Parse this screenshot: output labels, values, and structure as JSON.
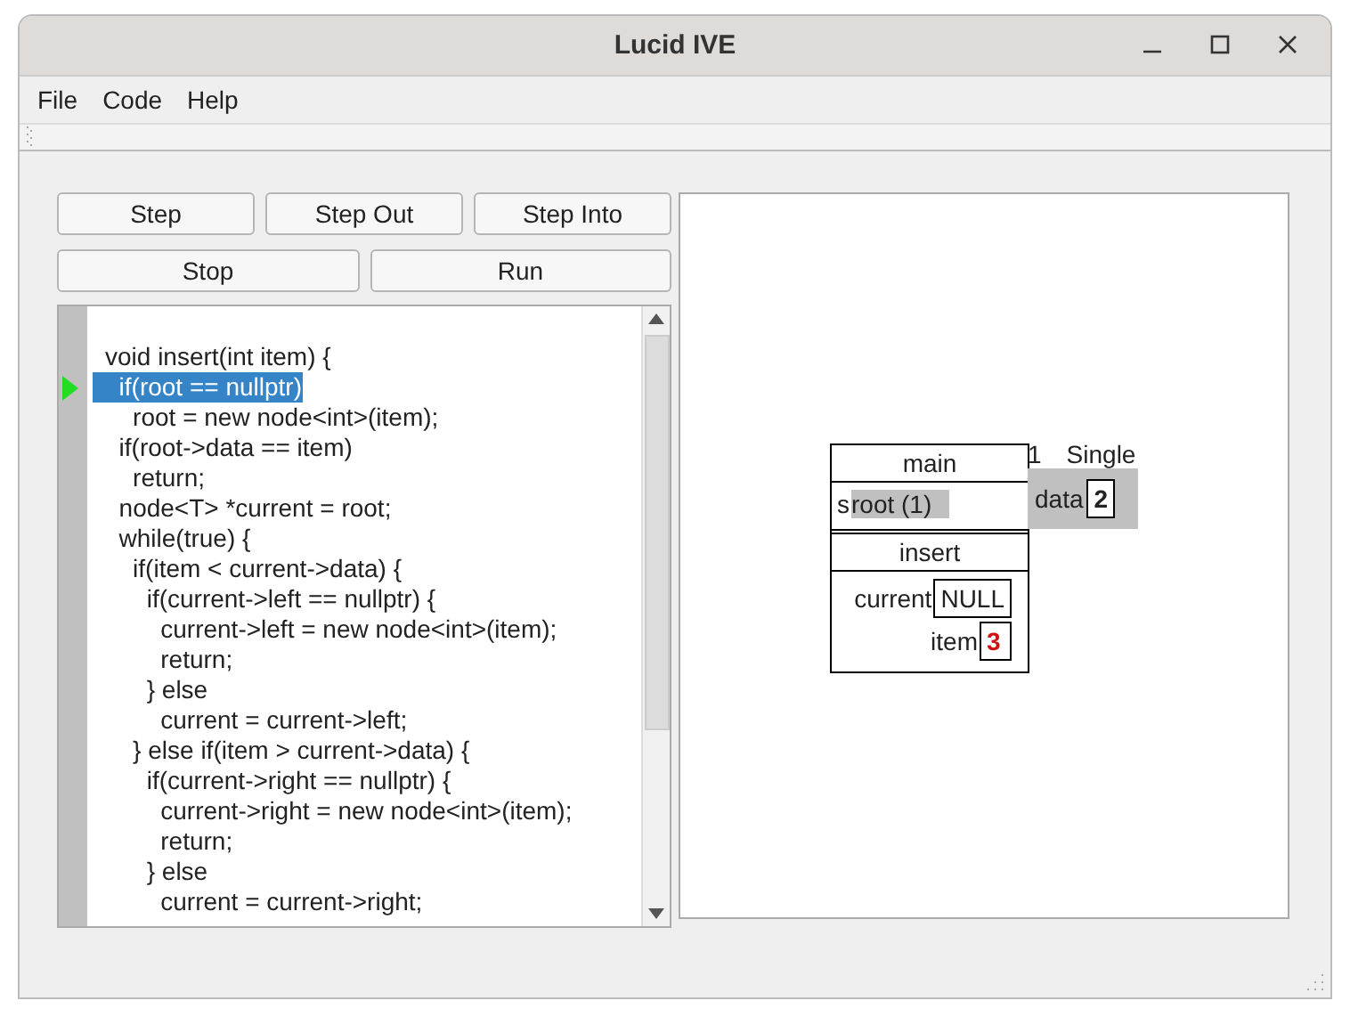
{
  "window": {
    "title": "Lucid IVE"
  },
  "menu": [
    "File",
    "Code",
    "Help"
  ],
  "buttons": [
    [
      "Step",
      "Step Out",
      "Step Into"
    ],
    [
      "Stop",
      "Run"
    ]
  ],
  "code": {
    "lines": [
      {
        "text": "void insert(int item) {",
        "current": false,
        "selected": false
      },
      {
        "text": "  if(root == nullptr)",
        "current": true,
        "selected": true
      },
      {
        "text": "    root = new node<int>(item);",
        "current": false,
        "selected": false
      },
      {
        "text": "  if(root->data == item)",
        "current": false,
        "selected": false
      },
      {
        "text": "    return;",
        "current": false,
        "selected": false
      },
      {
        "text": "  node<T> *current = root;",
        "current": false,
        "selected": false
      },
      {
        "text": "  while(true) {",
        "current": false,
        "selected": false
      },
      {
        "text": "    if(item < current->data) {",
        "current": false,
        "selected": false
      },
      {
        "text": "      if(current->left == nullptr) {",
        "current": false,
        "selected": false
      },
      {
        "text": "        current->left = new node<int>(item);",
        "current": false,
        "selected": false
      },
      {
        "text": "        return;",
        "current": false,
        "selected": false
      },
      {
        "text": "      } else",
        "current": false,
        "selected": false
      },
      {
        "text": "        current = current->left;",
        "current": false,
        "selected": false
      },
      {
        "text": "    } else if(item > current->data) {",
        "current": false,
        "selected": false
      },
      {
        "text": "      if(current->right == nullptr) {",
        "current": false,
        "selected": false
      },
      {
        "text": "        current->right = new node<int>(item);",
        "current": false,
        "selected": false
      },
      {
        "text": "        return;",
        "current": false,
        "selected": false
      },
      {
        "text": "      } else",
        "current": false,
        "selected": false
      },
      {
        "text": "        current = current->right;",
        "current": false,
        "selected": false
      }
    ]
  },
  "stack": [
    {
      "name": "main",
      "vars": [
        {
          "kind": "pointer",
          "prefix": "s",
          "label": "root (1)"
        }
      ]
    },
    {
      "name": "insert",
      "vars": [
        {
          "kind": "value",
          "label": "current",
          "value": "NULL",
          "changed": false
        },
        {
          "kind": "value",
          "label": "item",
          "value": "3",
          "changed": true
        }
      ]
    }
  ],
  "heap": [
    {
      "id": "1",
      "type": "Single",
      "fields": [
        {
          "label": "data",
          "value": "2",
          "changed": false
        }
      ]
    }
  ]
}
